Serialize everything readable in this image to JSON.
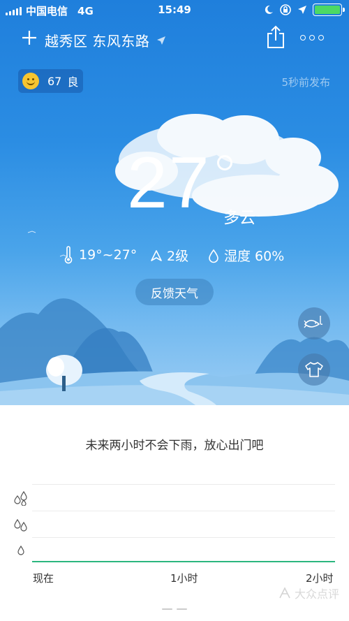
{
  "status_bar": {
    "carrier": "中国电信",
    "network": "4G",
    "time": "15:49",
    "icons": [
      "signal-icon",
      "moon-icon",
      "rotation-lock-icon",
      "location-arrow-icon",
      "battery-icon"
    ],
    "battery_color": "#4cd964"
  },
  "header": {
    "add_icon": "plus-icon",
    "location": "越秀区 东风东路",
    "share_icon": "share-icon",
    "more_icon": "more-icon"
  },
  "aqi": {
    "value": "67",
    "level": "良",
    "icon": "smiley-face-icon"
  },
  "publish_time": "5秒前发布",
  "current": {
    "temperature": "27",
    "condition": "多云"
  },
  "details": {
    "temp_range": "19°~27°",
    "wind": "2级",
    "humidity": "湿度 60%"
  },
  "feedback_label": "反馈天气",
  "side_buttons": [
    "fishing-icon",
    "tshirt-icon"
  ],
  "forecast_text": "未来两小时不会下雨，放心出门吧",
  "rain_chart": {
    "x_labels": [
      "现在",
      "1小时",
      "2小时"
    ],
    "accent_color": "#2bb67f"
  },
  "watermark": "大众点评"
}
